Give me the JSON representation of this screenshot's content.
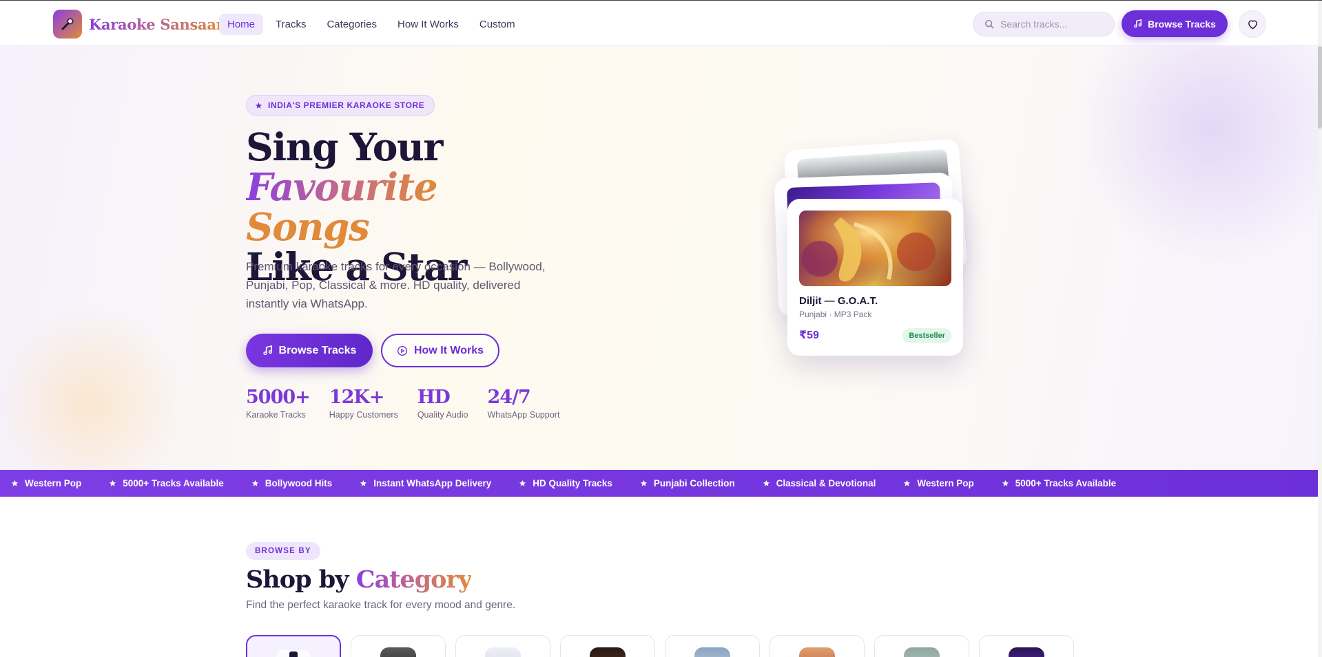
{
  "brand": {
    "name": "Karaoke Sansaar"
  },
  "nav": {
    "items": [
      {
        "label": "Home",
        "active": true
      },
      {
        "label": "Tracks",
        "active": false
      },
      {
        "label": "Categories",
        "active": false
      },
      {
        "label": "How It Works",
        "active": false
      },
      {
        "label": "Custom",
        "active": false
      }
    ]
  },
  "header": {
    "search_placeholder": "Search tracks...",
    "browse_label": "Browse Tracks"
  },
  "hero": {
    "tag": "INDIA'S PREMIER KARAOKE STORE",
    "title_part1": "Sing Your ",
    "title_highlight1": "Favourite",
    "title_highlight2": "Songs",
    "title_part2": "Like a Star",
    "description": "Premium karaoke tracks for every occasion — Bollywood, Punjabi, Pop, Classical & more. HD quality, delivered instantly via WhatsApp.",
    "primary_button": "Browse Tracks",
    "secondary_button": "How It Works",
    "stats": [
      {
        "value": "5000+",
        "label": "Karaoke Tracks"
      },
      {
        "value": "12K+",
        "label": "Happy Customers"
      },
      {
        "value": "HD",
        "label": "Quality Audio"
      },
      {
        "value": "24/7",
        "label": "WhatsApp Support"
      }
    ]
  },
  "featured_card": {
    "title": "Diljit — G.O.A.T.",
    "subtitle": "Punjabi · MP3 Pack",
    "price": "₹59",
    "badge": "Bestseller"
  },
  "ticker": {
    "items": [
      "Western Pop",
      "5000+ Tracks Available",
      "Bollywood Hits",
      "Instant WhatsApp Delivery",
      "HD Quality Tracks",
      "Punjabi Collection",
      "Classical & Devotional",
      "Western Pop",
      "5000+ Tracks Available"
    ]
  },
  "categories_section": {
    "tag": "BROWSE BY",
    "title_part1": "Shop by ",
    "title_highlight": "Category",
    "subtitle": "Find the perfect karaoke track for every mood and genre."
  },
  "colors": {
    "accent": "#6d2fd8",
    "accent_light": "#efe6fb",
    "brand_orange": "#e08a3a",
    "text_dark": "#1c1638",
    "success_bg": "#e2f7ea",
    "success_text": "#1c8a4a"
  }
}
